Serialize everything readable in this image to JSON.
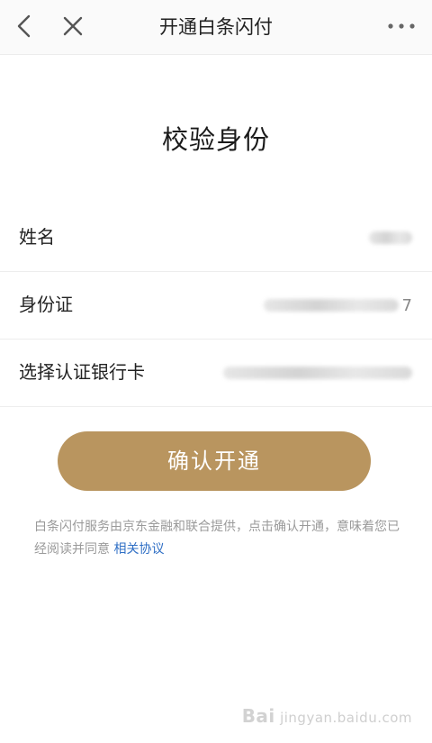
{
  "header": {
    "title": "开通白条闪付",
    "back_icon": "chevron-left-icon",
    "close_icon": "close-icon",
    "more_icon": "more-horizontal-icon"
  },
  "main": {
    "heading": "校验身份",
    "rows": [
      {
        "label": "姓名",
        "value_masked": true
      },
      {
        "label": "身份证",
        "value_masked": true,
        "value_tail": "7"
      },
      {
        "label": "选择认证银行卡",
        "value_masked": true
      }
    ],
    "confirm_button": "确认开通",
    "disclaimer_text": "白条闪付服务由京东金融和联合提供，点击确认开通，意味着您已经阅读并同意",
    "agreement_link": "相关协议"
  },
  "colors": {
    "button": "#b9955f",
    "link": "#2f6fc5",
    "muted_text": "#9a9a9a"
  },
  "watermark": {
    "brand": "Bai",
    "sub": "jingyan.baidu.com"
  }
}
